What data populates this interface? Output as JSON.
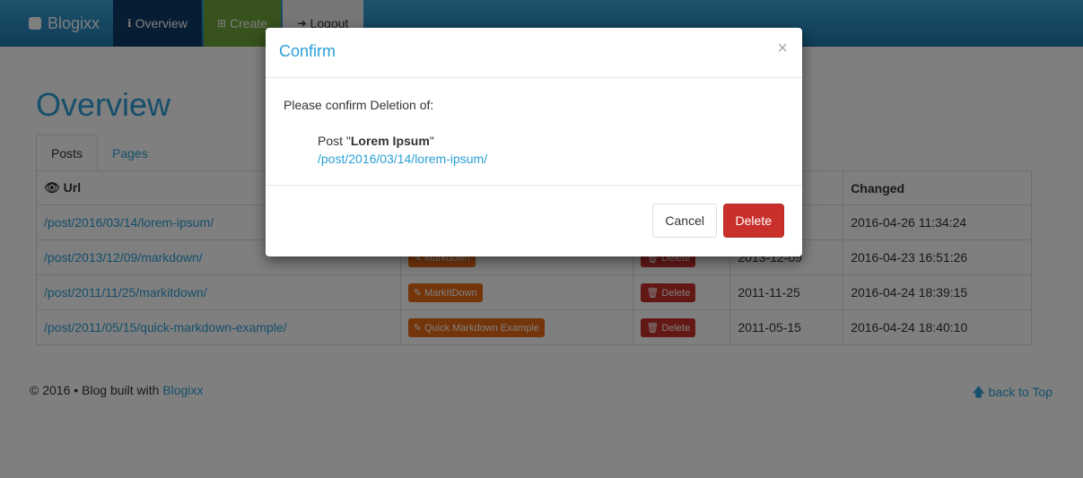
{
  "nav": {
    "brand": "Blogixx",
    "overview": "Overview",
    "create": "Create",
    "logout": "Logout",
    "overview_icon": "info-icon",
    "create_icon": "plus-square-icon",
    "logout_icon": "sign-out-icon"
  },
  "page": {
    "title": "Overview",
    "tabs": [
      "Posts",
      "Pages"
    ]
  },
  "table": {
    "headers": {
      "url": "Url",
      "changed": "Changed"
    },
    "rows": [
      {
        "url": "/post/2016/03/14/lorem-ipsum/",
        "changed": "2016-04-26 11:34:24"
      },
      {
        "url": "/post/2013/12/09/markdown/",
        "edit": "Markdown",
        "delete": "Delete",
        "created": "2013-12-09",
        "changed": "2016-04-23 16:51:26"
      },
      {
        "url": "/post/2011/11/25/markitdown/",
        "edit": "MarkItDown",
        "delete": "Delete",
        "created": "2011-11-25",
        "changed": "2016-04-24 18:39:15"
      },
      {
        "url": "/post/2011/05/15/quick-markdown-example/",
        "edit": "Quick Markdown Example",
        "delete": "Delete",
        "created": "2011-05-15",
        "changed": "2016-04-24 18:40:10"
      }
    ]
  },
  "footer": {
    "copyright": "© 2016 • Blog built with ",
    "link": "Blogixx",
    "back_to_top": "back to Top"
  },
  "modal": {
    "title": "Confirm",
    "close": "×",
    "confirm_text": "Please confirm Deletion of:",
    "post_prefix": "Post \"",
    "post_name": "Lorem Ipsum",
    "post_suffix": "\"",
    "post_url": "/post/2016/03/14/lorem-ipsum/",
    "cancel": "Cancel",
    "delete": "Delete"
  },
  "colors": {
    "accent": "#2a9fd6",
    "danger": "#c9302c",
    "warning": "#e96b16",
    "nav_active": "#0d3b66",
    "nav_create": "#6fa43a"
  }
}
